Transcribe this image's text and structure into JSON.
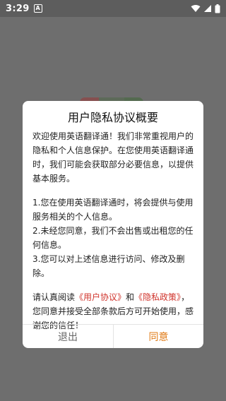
{
  "status_bar": {
    "time": "3:29",
    "notification_letter": "A",
    "icons": [
      "wifi-icon",
      "signal-icon",
      "battery-icon"
    ]
  },
  "dialog": {
    "title": "用户隐私协议概要",
    "intro": "欢迎使用英语翻译通！我们非常重视用户的隐私和个人信息保护。在您使用英语翻译通时，我们可能会获取部分必要信息，以提供基本服务。",
    "point1": "1.您在使用英语翻译通时，将会提供与使用服务相关的个人信息。",
    "point2": "2.未经您同意，我们不会出售或出租您的任何信息。",
    "point3": "3.您可以对上述信息进行访问、修改及删除。",
    "closing": {
      "before_links": "请认真阅读",
      "user_agreement_link": "《用户协议》",
      "and": "和",
      "privacy_policy_link": "《隐私政策》",
      "after_links": "，您同意并接受全部条款后方可开始使用，感谢您的信任！"
    },
    "exit_label": "退出",
    "agree_label": "同意"
  },
  "colors": {
    "link": "#d0342c",
    "agree": "#e07b16",
    "exit": "#666666",
    "overlay": "#6e6e6e"
  }
}
